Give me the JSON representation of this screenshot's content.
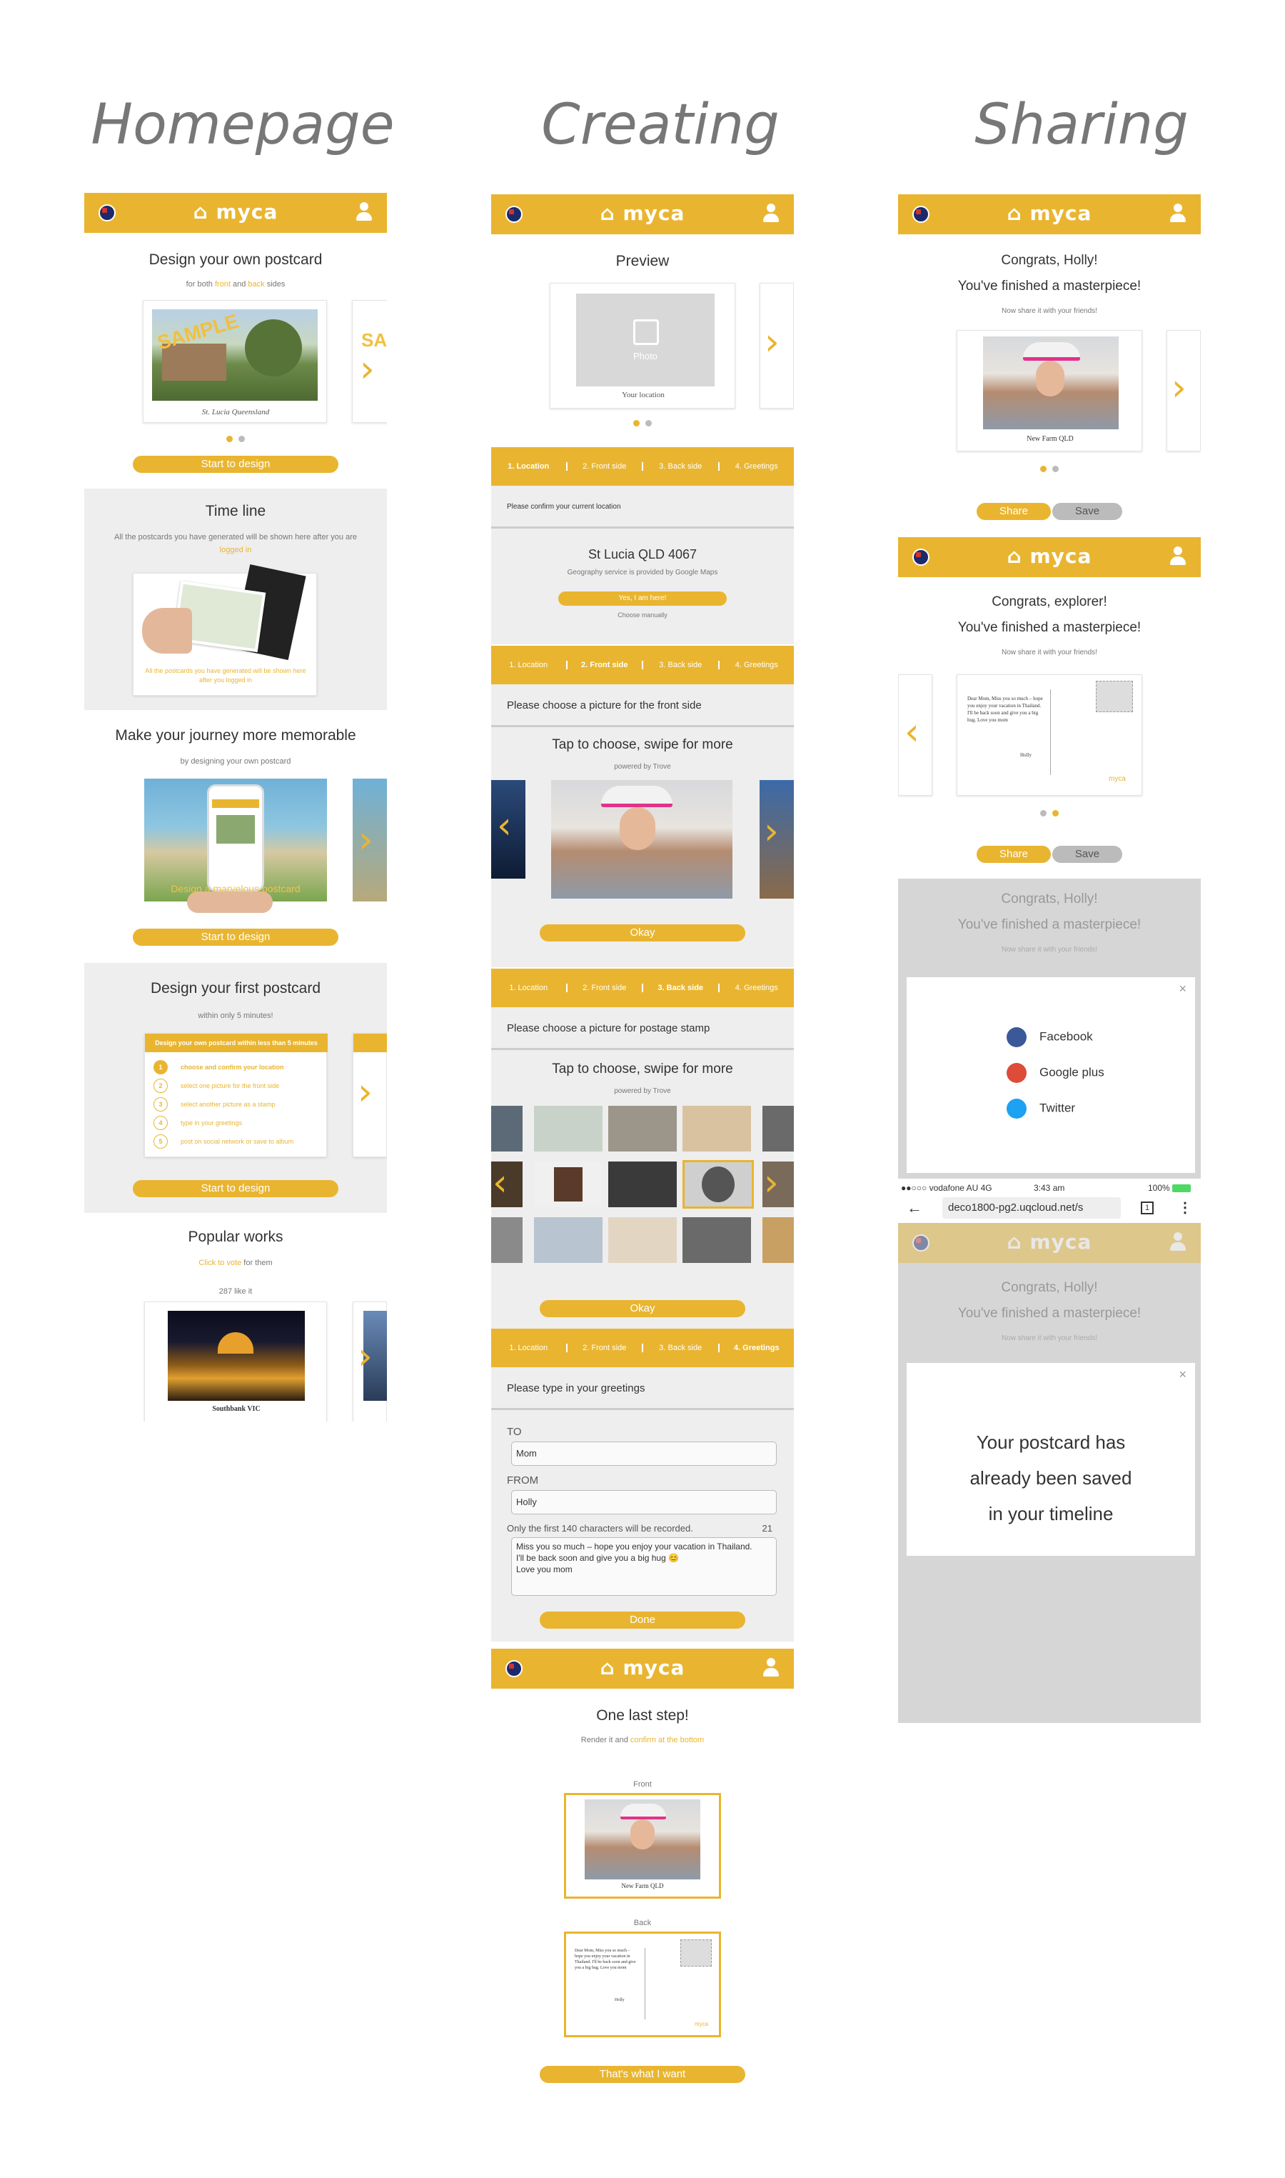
{
  "columns": {
    "home": "Homepage",
    "create": "Creating",
    "share": "Sharing"
  },
  "brand": {
    "logo_text": "myca",
    "accent": "#e9b530",
    "grey": "#eeeeee"
  },
  "icons": {
    "home": "home-icon",
    "user": "user-icon",
    "flag": "australia-flag-icon",
    "next": "chevron-right-icon",
    "prev": "chevron-left-icon",
    "close": "close-icon"
  },
  "homepage": {
    "design": {
      "title": "Design your own postcard",
      "sub_a": "for both ",
      "sub_front": "front",
      "sub_and": " and ",
      "sub_back": "back",
      "sub_b": " sides",
      "sample": "SAMPLE",
      "caption": "St. Lucia Queensland",
      "button": "Start to design"
    },
    "timeline": {
      "title": "Time line",
      "desc": "All the postcards you have generated will be shown here after you are",
      "link": "logged in",
      "overlay_text": "All the postcards you have generated will be shown here after you logged in"
    },
    "journey": {
      "title": "Make your journey more memorable",
      "sub": "by designing your own postcard",
      "overlay": "Design a marvelous postcard",
      "button": "Start to design"
    },
    "first": {
      "title": "Design your first postcard",
      "sub": "within only 5 minutes!",
      "card_header": "Design your own postcard within less than 5 minutes",
      "steps": [
        "choose and confirm your location",
        "select one picture for the front side",
        "select another picture as a stamp",
        "type in your greetings",
        "post on social network or save to album"
      ],
      "button": "Start to design"
    },
    "popular": {
      "title": "Popular works",
      "link": "Click to vote",
      "after": " for them",
      "likes": "287 like it",
      "caption": "Southbank VIC"
    }
  },
  "creating": {
    "preview": {
      "title": "Preview",
      "photo_label": "Photo",
      "location": "Your location"
    },
    "steps": [
      "1. Location",
      "2. Front side",
      "3. Back side",
      "4. Greetings"
    ],
    "location": {
      "prompt": "Please confirm your current location",
      "place": "St Lucia QLD 4067",
      "service": "Geography service is provided by Google Maps",
      "confirm": "Yes, I am here!",
      "manual": "Choose manually"
    },
    "front": {
      "prompt": "Please choose a picture for the front side",
      "title": "Tap to choose, swipe for more",
      "powered": "powered by Trove",
      "button": "Okay"
    },
    "stamp": {
      "prompt": "Please choose a picture for postage stamp",
      "title": "Tap to choose, swipe for more",
      "powered": "powered by Trove",
      "button": "Okay"
    },
    "greetings": {
      "prompt": "Please type in your greetings",
      "to_label": "TO",
      "to_value": "Mom",
      "from_label": "FROM",
      "from_value": "Holly",
      "limit_note": "Only the first 140 characters will be recorded.",
      "count": "21",
      "message": [
        "Miss you so much – hope you enjoy your vacation in Thailand.",
        "I'll be back soon and give you a big hug 😊",
        "Love you mom"
      ],
      "button": "Done"
    },
    "final": {
      "title": "One last step!",
      "sub": "Render it and ",
      "link": "confirm at the bottom",
      "front_label": "Front",
      "back_label": "Back",
      "front_caption": "New Farm QLD",
      "button": "That's what I want"
    }
  },
  "sharing": {
    "s1": {
      "line1": "Congrats, Holly!",
      "line2": "You've finished a masterpiece!",
      "sub": "Now share it with your friends!",
      "caption": "New Farm QLD",
      "share": "Share",
      "save": "Save"
    },
    "s2": {
      "line1": "Congrats, explorer!",
      "line2": "You've finished a masterpiece!",
      "sub": "Now share it with your friends!",
      "letter": "Dear Mom, Miss you so much – hope you enjoy your vacation in Thailand. I'll be back soon and give you a big hug. Love you mom",
      "signature": "Holly",
      "share": "Share",
      "save": "Save"
    },
    "s3": {
      "line1": "Congrats, Holly!",
      "line2": "You've finished a masterpiece!",
      "sub": "Now share it with your friends!",
      "options": [
        "Facebook",
        "Google plus",
        "Twitter"
      ]
    },
    "s4": {
      "carrier": "●●○○○ vodafone AU  4G",
      "time": "3:43 am",
      "battery": "100%",
      "url": "deco1800-pg2.uqcloud.net/s",
      "tabs": "1",
      "line1": "Congrats, Holly!",
      "line2": "You've finished a masterpiece!",
      "sub": "Now share it with your friends!",
      "saved": [
        "Your postcard has",
        "already been saved",
        "in your timeline"
      ]
    }
  }
}
